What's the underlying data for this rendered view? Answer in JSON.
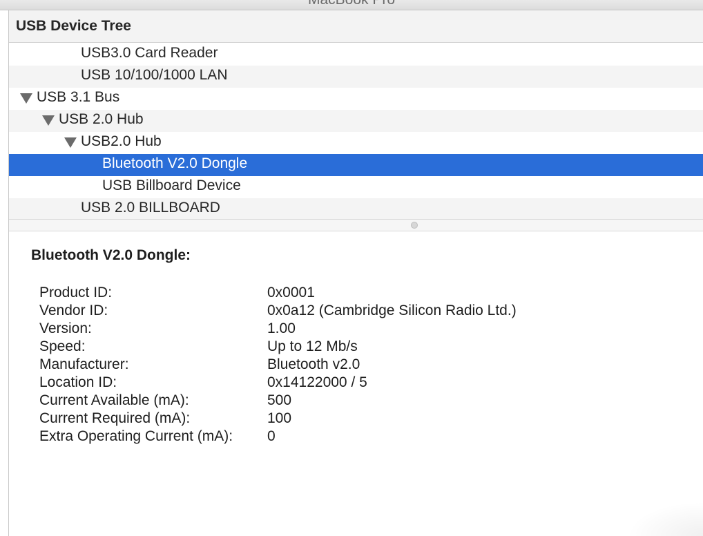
{
  "window": {
    "title": "MacBook Pro"
  },
  "tree": {
    "header": "USB Device Tree",
    "rows": [
      {
        "label": "USB3.0 Card Reader",
        "indent": 3,
        "expanded": null,
        "selected": false
      },
      {
        "label": "USB 10/100/1000 LAN",
        "indent": 3,
        "expanded": null,
        "selected": false
      },
      {
        "label": "USB 3.1 Bus",
        "indent": 0,
        "expanded": true,
        "selected": false
      },
      {
        "label": "USB 2.0 Hub",
        "indent": 1,
        "expanded": true,
        "selected": false
      },
      {
        "label": "USB2.0 Hub",
        "indent": 2,
        "expanded": true,
        "selected": false
      },
      {
        "label": "Bluetooth V2.0 Dongle",
        "indent": 4,
        "expanded": null,
        "selected": true
      },
      {
        "label": "USB Billboard Device",
        "indent": 4,
        "expanded": null,
        "selected": false
      },
      {
        "label": "USB 2.0 BILLBOARD",
        "indent": 3,
        "expanded": null,
        "selected": false
      }
    ]
  },
  "detail": {
    "title": "Bluetooth V2.0 Dongle:",
    "properties": [
      {
        "key": "Product ID:",
        "value": "0x0001"
      },
      {
        "key": "Vendor ID:",
        "value": "0x0a12  (Cambridge Silicon Radio Ltd.)"
      },
      {
        "key": "Version:",
        "value": "1.00"
      },
      {
        "key": "Speed:",
        "value": "Up to 12 Mb/s"
      },
      {
        "key": "Manufacturer:",
        "value": "Bluetooth v2.0"
      },
      {
        "key": "Location ID:",
        "value": "0x14122000 / 5"
      },
      {
        "key": "Current Available (mA):",
        "value": "500"
      },
      {
        "key": "Current Required (mA):",
        "value": "100"
      },
      {
        "key": "Extra Operating Current (mA):",
        "value": "0"
      }
    ]
  },
  "colors": {
    "selection": "#2a6dd8",
    "alt_row": "#f4f4f4",
    "disclosure": "#6b6b6b"
  },
  "icons": {
    "disclosure": "disclosure-triangle-icon",
    "splitter": "splitter-handle-icon"
  }
}
